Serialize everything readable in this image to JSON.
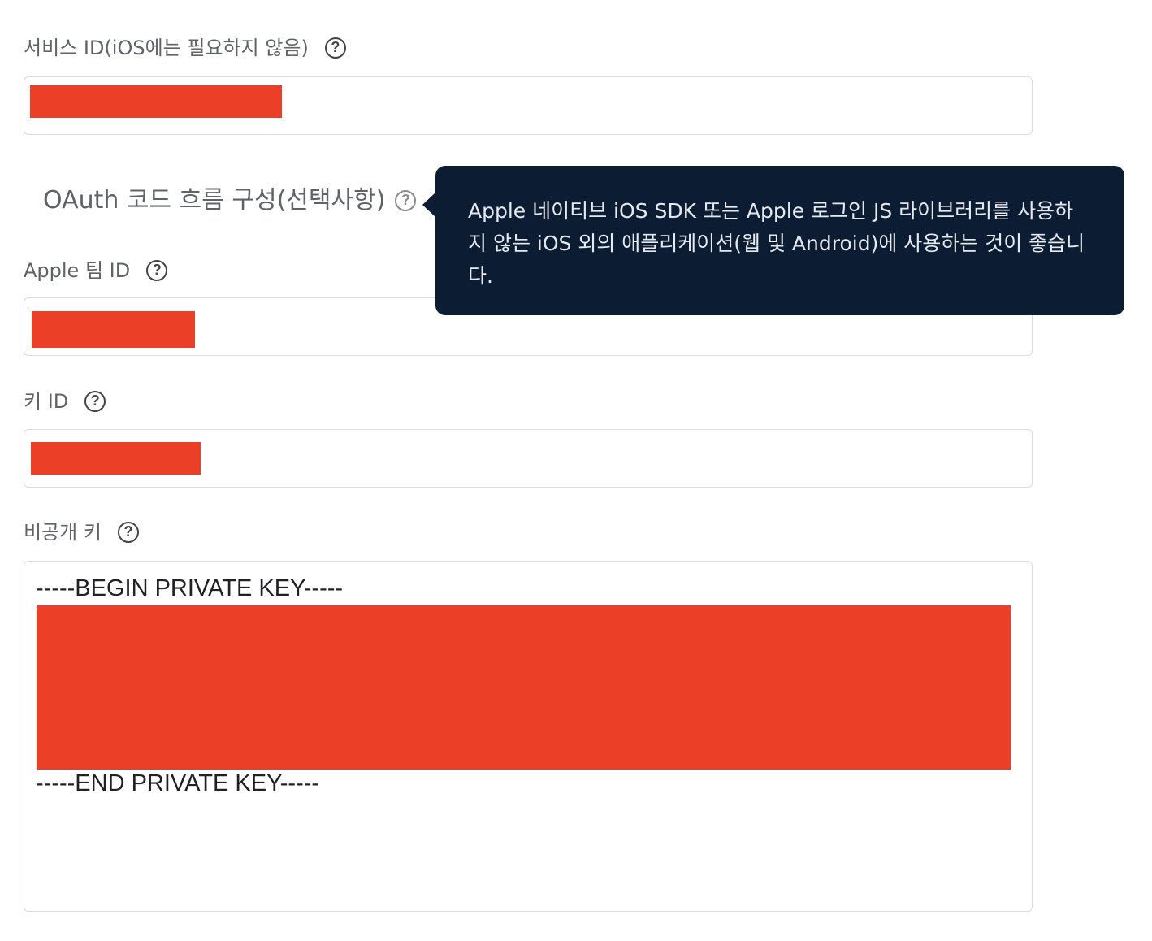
{
  "fields": {
    "service_id": {
      "label": "서비스 ID(iOS에는 필요하지 않음)"
    },
    "team_id": {
      "label": "Apple 팀 ID"
    },
    "key_id": {
      "label": "키 ID"
    },
    "private_key": {
      "label": "비공개 키",
      "begin": "-----BEGIN PRIVATE KEY-----",
      "end": "-----END PRIVATE KEY-----"
    }
  },
  "oauth": {
    "label": "OAuth 코드 흐름 구성(선택사항)"
  },
  "tooltip": {
    "text": "Apple 네이티브 iOS SDK 또는 Apple 로그인 JS 라이브러리를 사용하지 않는 iOS 외의 애플리케이션(웹 및 Android)에 사용하는 것이 좋습니다."
  },
  "icons": {
    "help": "help-circle-icon"
  },
  "colors": {
    "redaction": "#eb4027",
    "tooltip_bg": "#0c1d33",
    "border": "#dadce0"
  }
}
